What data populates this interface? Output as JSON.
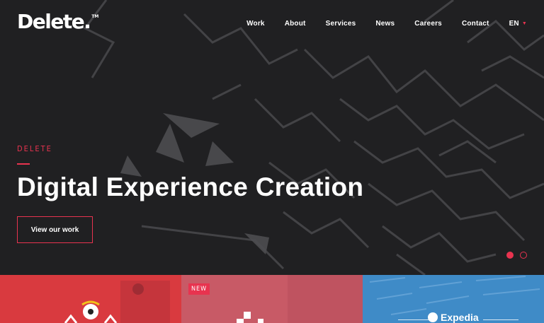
{
  "brand": {
    "logo_text": "Delete.",
    "trademark": "TM"
  },
  "nav": {
    "items": [
      {
        "label": "Work"
      },
      {
        "label": "About"
      },
      {
        "label": "Services"
      },
      {
        "label": "News"
      },
      {
        "label": "Careers"
      },
      {
        "label": "Contact"
      }
    ],
    "language": {
      "label": "EN",
      "icon": "chevron-down-icon"
    }
  },
  "hero": {
    "eyebrow": "DELETE",
    "headline": "Digital Experience Creation",
    "cta_label": "View our work",
    "slides": {
      "total": 2,
      "active": 1
    }
  },
  "tiles": [
    {
      "name": "football-club-tile"
    },
    {
      "name": "university-tile",
      "badge": "NEW"
    },
    {
      "name": "expedia-tile",
      "logo_text": "Expedia"
    }
  ],
  "colors": {
    "accent": "#e8334f",
    "hero_bg": "#202022",
    "tile1": "#d93a3f",
    "tile2": "#c85a66",
    "tile3": "#3f8bc7"
  }
}
